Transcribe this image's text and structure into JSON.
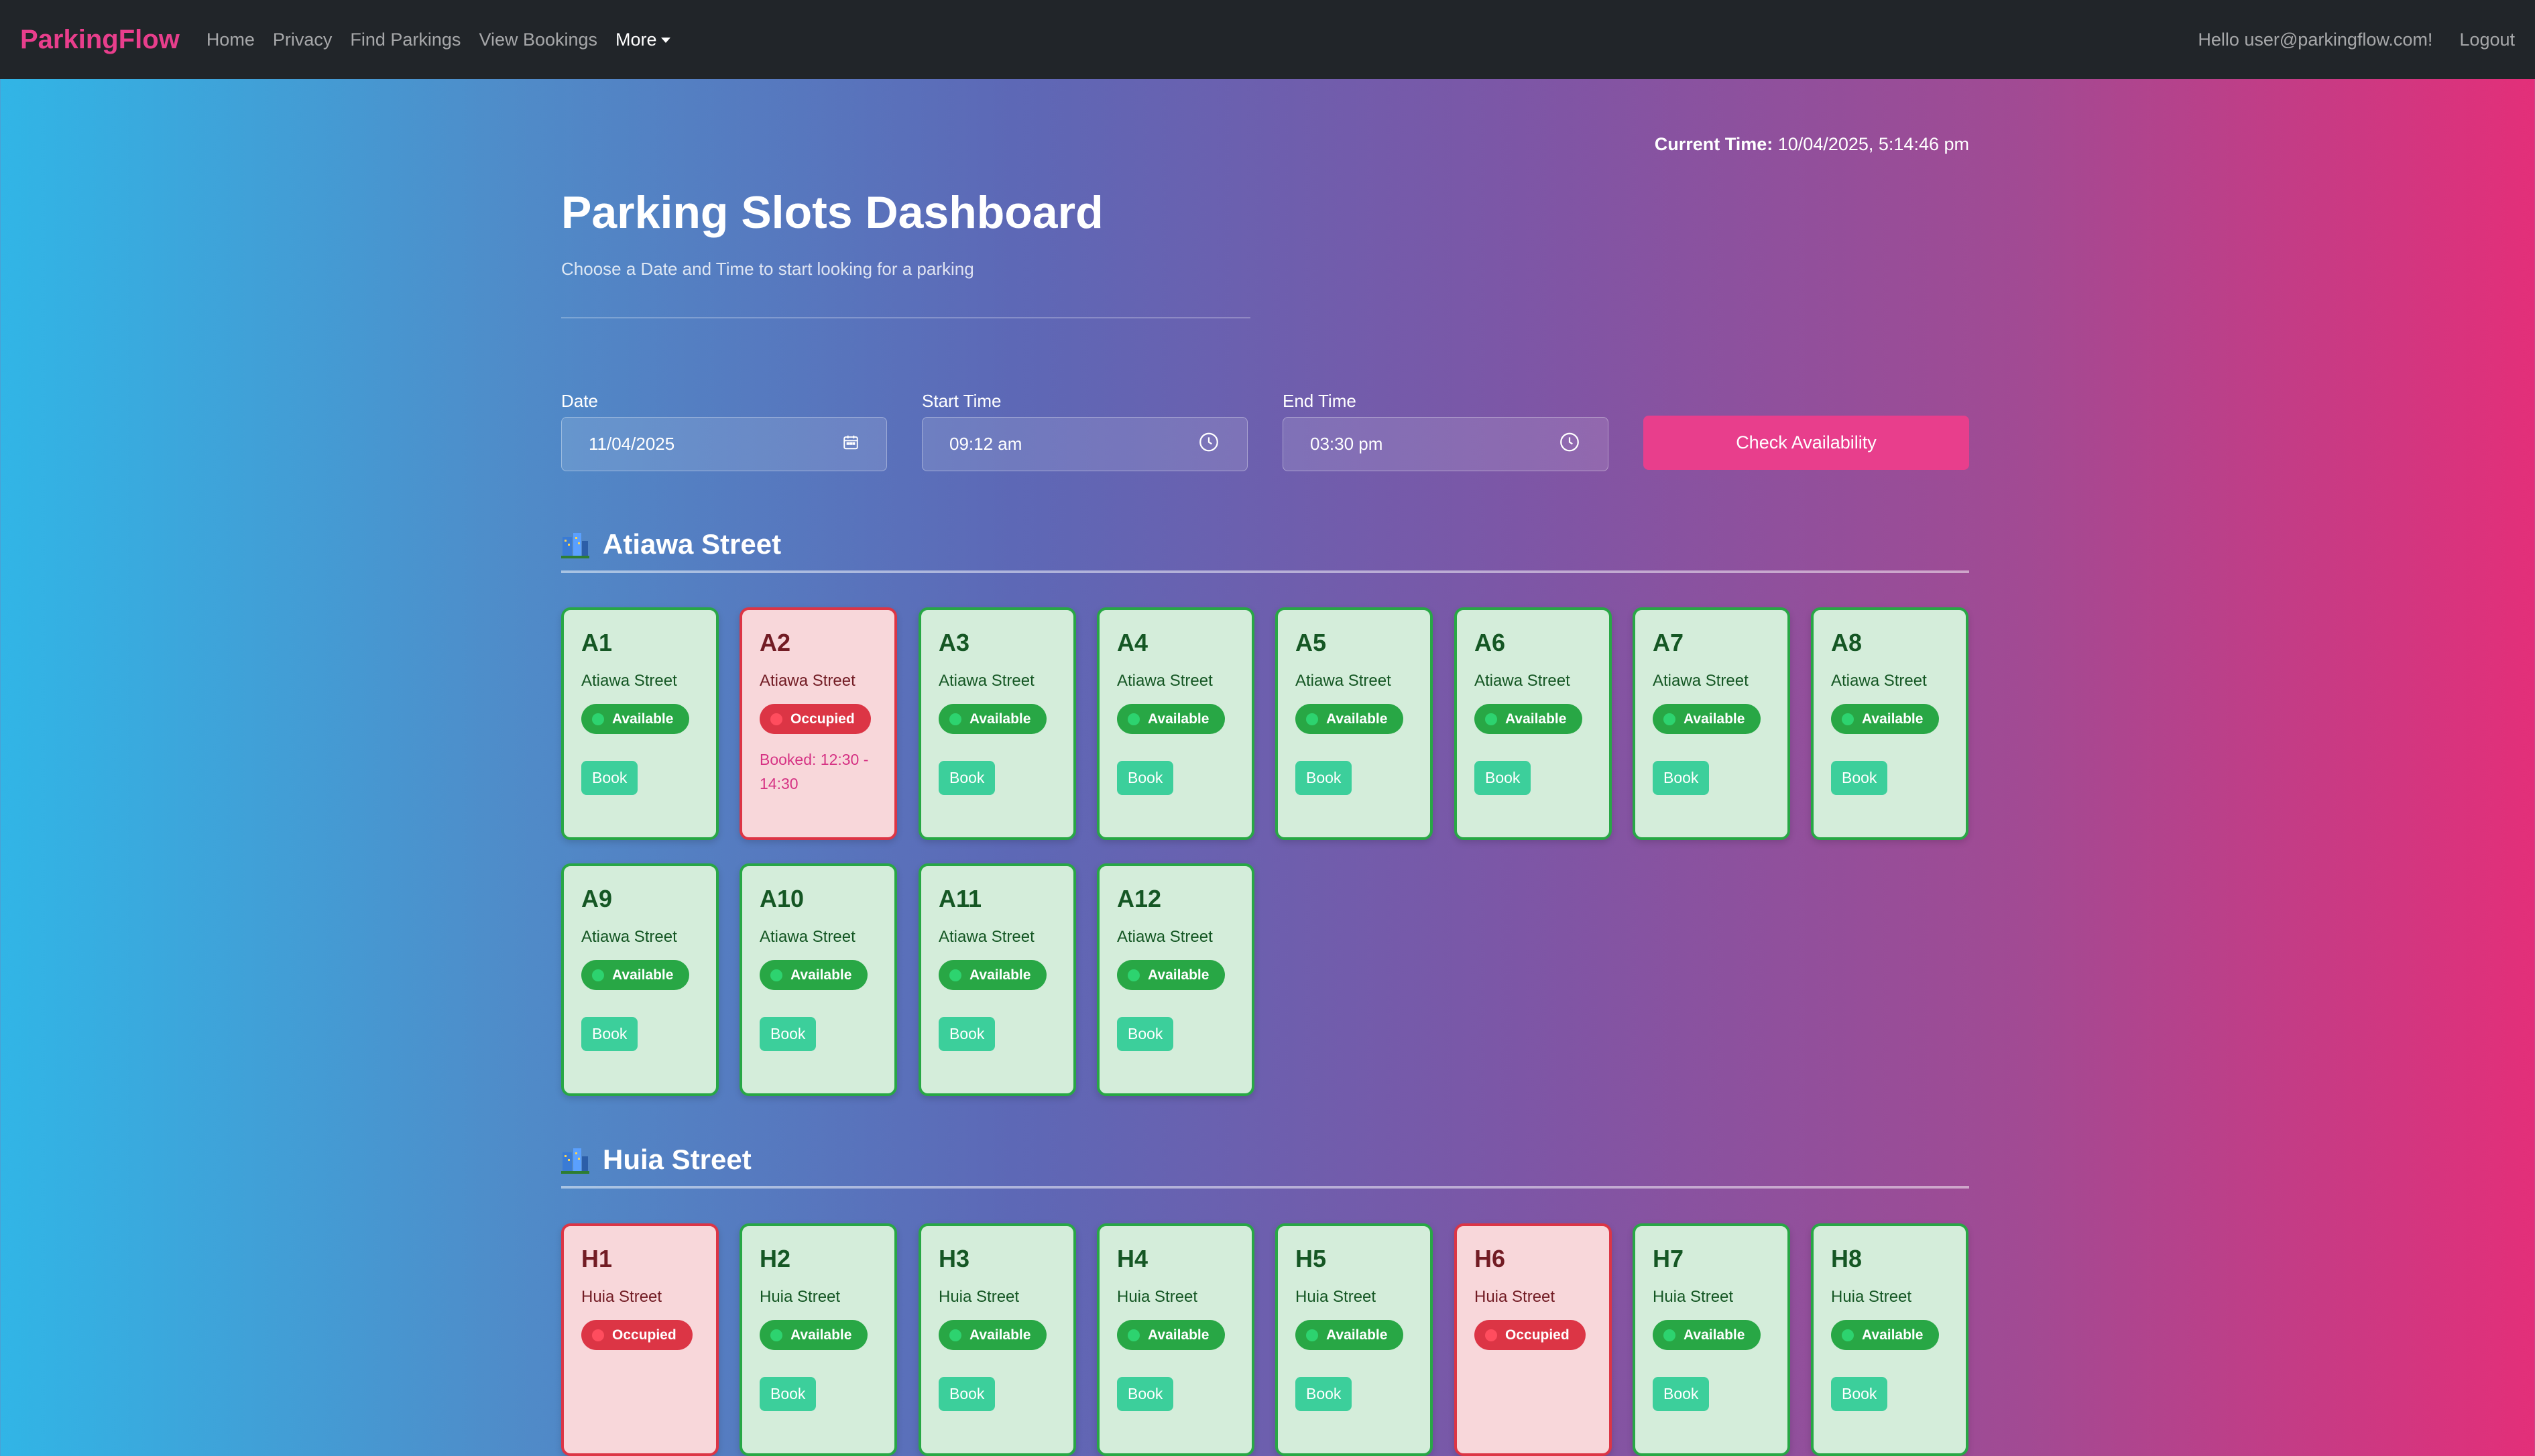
{
  "nav": {
    "brand": "ParkingFlow",
    "links": [
      "Home",
      "Privacy",
      "Find Parkings",
      "View Bookings"
    ],
    "more": "More",
    "greeting": "Hello user@parkingflow.com!",
    "logout": "Logout"
  },
  "header": {
    "current_time_label": "Current Time:",
    "current_time_value": "10/04/2025, 5:14:46 pm",
    "title": "Parking Slots Dashboard",
    "subtitle": "Choose a Date and Time to start looking for a parking"
  },
  "form": {
    "date_label": "Date",
    "date_value": "11/04/2025",
    "start_label": "Start Time",
    "start_value": "09:12 am",
    "end_label": "End Time",
    "end_value": "03:30 pm",
    "check_button": "Check Availability"
  },
  "sections": [
    {
      "name": "Atiawa Street",
      "slots": [
        {
          "id": "A1",
          "street": "Atiawa Street",
          "status": "Available"
        },
        {
          "id": "A2",
          "street": "Atiawa Street",
          "status": "Occupied",
          "booked": "Booked: 12:30 - 14:30"
        },
        {
          "id": "A3",
          "street": "Atiawa Street",
          "status": "Available"
        },
        {
          "id": "A4",
          "street": "Atiawa Street",
          "status": "Available"
        },
        {
          "id": "A5",
          "street": "Atiawa Street",
          "status": "Available"
        },
        {
          "id": "A6",
          "street": "Atiawa Street",
          "status": "Available"
        },
        {
          "id": "A7",
          "street": "Atiawa Street",
          "status": "Available"
        },
        {
          "id": "A8",
          "street": "Atiawa Street",
          "status": "Available"
        },
        {
          "id": "A9",
          "street": "Atiawa Street",
          "status": "Available"
        },
        {
          "id": "A10",
          "street": "Atiawa Street",
          "status": "Available"
        },
        {
          "id": "A11",
          "street": "Atiawa Street",
          "status": "Available"
        },
        {
          "id": "A12",
          "street": "Atiawa Street",
          "status": "Available"
        }
      ]
    },
    {
      "name": "Huia Street",
      "slots": [
        {
          "id": "H1",
          "street": "Huia Street",
          "status": "Occupied"
        },
        {
          "id": "H2",
          "street": "Huia Street",
          "status": "Available"
        },
        {
          "id": "H3",
          "street": "Huia Street",
          "status": "Available"
        },
        {
          "id": "H4",
          "street": "Huia Street",
          "status": "Available"
        },
        {
          "id": "H5",
          "street": "Huia Street",
          "status": "Available"
        },
        {
          "id": "H6",
          "street": "Huia Street",
          "status": "Occupied"
        },
        {
          "id": "H7",
          "street": "Huia Street",
          "status": "Available"
        },
        {
          "id": "H8",
          "street": "Huia Street",
          "status": "Available"
        }
      ]
    }
  ],
  "book_label": "Book",
  "colors": {
    "brand": "#e83e8c",
    "available_bg": "#d4edda",
    "available_border": "#28a745",
    "occupied_bg": "#f8d7da",
    "occupied_border": "#dc3545",
    "book_button": "#3ccf9b"
  },
  "icons": {
    "date_field": "calendar-icon",
    "time_field": "clock-icon",
    "section": "city-icon",
    "status": "status-dot-icon"
  }
}
